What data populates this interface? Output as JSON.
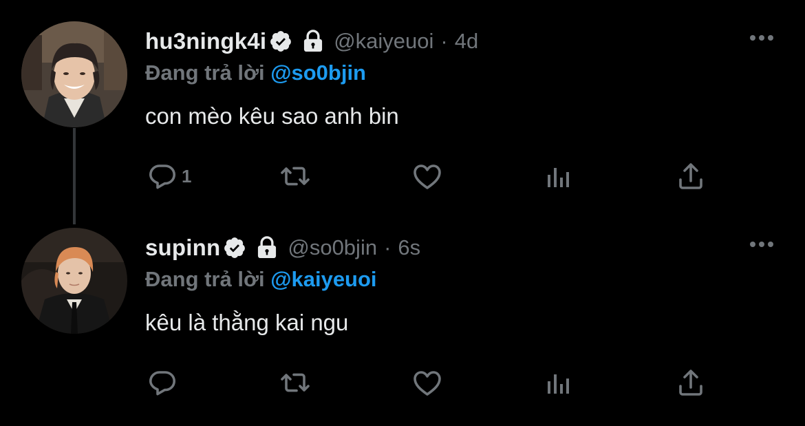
{
  "colors": {
    "background": "#000000",
    "text": "#e7e9ea",
    "muted": "#71767b",
    "accent": "#1d9bf0",
    "thread_line": "#333639"
  },
  "tweets": [
    {
      "display_name": "hu3ningk4i",
      "verified": true,
      "protected": true,
      "handle": "@kaiyeuoi",
      "separator": "·",
      "time": "4d",
      "reply_prefix": "Đang trả lời",
      "reply_to": "@so0bjin",
      "text": "con mèo kêu sao anh bin",
      "reply_count": "1",
      "icons": [
        "reply-icon",
        "retweet-icon",
        "like-icon",
        "analytics-icon",
        "share-icon",
        "more-icon"
      ]
    },
    {
      "display_name": "supinn",
      "verified": true,
      "protected": true,
      "handle": "@so0bjin",
      "separator": "·",
      "time": "6s",
      "reply_prefix": "Đang trả lời",
      "reply_to": "@kaiyeuoi",
      "text": "kêu là thằng kai ngu",
      "reply_count": "",
      "icons": [
        "reply-icon",
        "retweet-icon",
        "like-icon",
        "analytics-icon",
        "share-icon",
        "more-icon"
      ]
    }
  ]
}
